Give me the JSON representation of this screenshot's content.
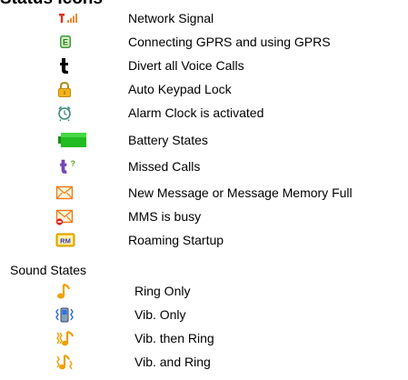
{
  "page": {
    "heading": "Status Icons",
    "status_icons": [
      {
        "icon": "network-signal-icon",
        "label": "Network Signal"
      },
      {
        "icon": "gprs-icon",
        "label": "Connecting GPRS and using GPRS"
      },
      {
        "icon": "divert-calls-icon",
        "label": "Divert all Voice Calls"
      },
      {
        "icon": "keypad-lock-icon",
        "label": "Auto Keypad Lock"
      },
      {
        "icon": "alarm-clock-icon",
        "label": "Alarm Clock is activated"
      },
      {
        "icon": "battery-icon",
        "label": "Battery States"
      },
      {
        "icon": "missed-calls-icon",
        "label": "Missed Calls"
      },
      {
        "icon": "new-message-icon",
        "label": "New Message or Message Memory Full"
      },
      {
        "icon": "mms-busy-icon",
        "label": "MMS is busy"
      },
      {
        "icon": "roaming-icon",
        "label": "Roaming Startup"
      }
    ],
    "sound_section_label": "Sound States",
    "sound_states": [
      {
        "icon": "ring-only-icon",
        "label": "Ring Only"
      },
      {
        "icon": "vib-only-icon",
        "label": "Vib. Only"
      },
      {
        "icon": "vib-then-ring-icon",
        "label": "Vib. then Ring"
      },
      {
        "icon": "vib-and-ring-icon",
        "label": "Vib. and Ring"
      }
    ],
    "colors": {
      "signal_red": "#e03020",
      "signal_orange": "#f08a30",
      "battery_green": "#22bb22",
      "lock_yellow": "#f0b418",
      "envelope_orange": "#f07a20",
      "envelope_fill": "#fff6d8",
      "note_orange": "#f0a000",
      "vib_blue": "#3070e0"
    }
  }
}
